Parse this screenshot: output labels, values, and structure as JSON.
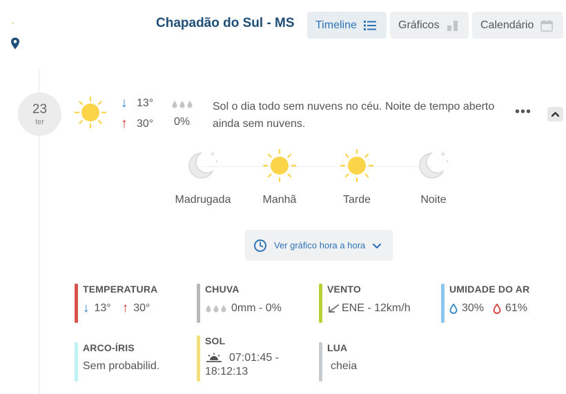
{
  "header": {
    "city": "Chapadão do Sul - MS",
    "tabs": [
      {
        "label": "Timeline",
        "icon": "list-icon",
        "active": true
      },
      {
        "label": "Gráficos",
        "icon": "bar-chart-icon",
        "active": false
      },
      {
        "label": "Calendário",
        "icon": "calendar-icon",
        "active": false
      }
    ]
  },
  "day": {
    "date_number": "23",
    "weekday": "ter",
    "icon": "sun-icon",
    "temp_min": "13°",
    "temp_max": "30°",
    "rain_percent": "0%",
    "description": "Sol o dia todo sem nuvens no céu. Noite de tempo aberto ainda sem nuvens.",
    "periods": [
      {
        "label": "Madrugada",
        "icon": "moon-icon"
      },
      {
        "label": "Manhã",
        "icon": "sun-icon"
      },
      {
        "label": "Tarde",
        "icon": "sun-icon"
      },
      {
        "label": "Noite",
        "icon": "moon-icon"
      }
    ],
    "hourly_link": "Ver gráfico hora a hora"
  },
  "details": {
    "temperatura": {
      "title": "TEMPERATURA",
      "min": "13°",
      "max": "30°",
      "color": "#d9534f"
    },
    "chuva": {
      "title": "CHUVA",
      "value": "0mm - 0%",
      "color": "#b8b8b8"
    },
    "vento": {
      "title": "VENTO",
      "value": "ENE - 12km/h",
      "color": "#b5d334"
    },
    "umidade": {
      "title": "UMIDADE DO AR",
      "min": "30%",
      "max": "61%",
      "color": "#8ec6ee"
    },
    "arco_iris": {
      "title": "ARCO-ÍRIS",
      "value": "Sem probabilid.",
      "color": "#bff0f2"
    },
    "sol": {
      "title": "SOL",
      "value_line1": "07:01:45 -",
      "value_line2": "18:12:13",
      "color": "#f3df7d"
    },
    "lua": {
      "title": "LUA",
      "value": "cheia",
      "color": "#c6cbd0"
    }
  },
  "colors": {
    "accent": "#2c73b8",
    "city": "#1f4e79",
    "sun": "#fbd44a",
    "min_arrow": "#2d85c8",
    "max_arrow": "#d83a3a"
  }
}
